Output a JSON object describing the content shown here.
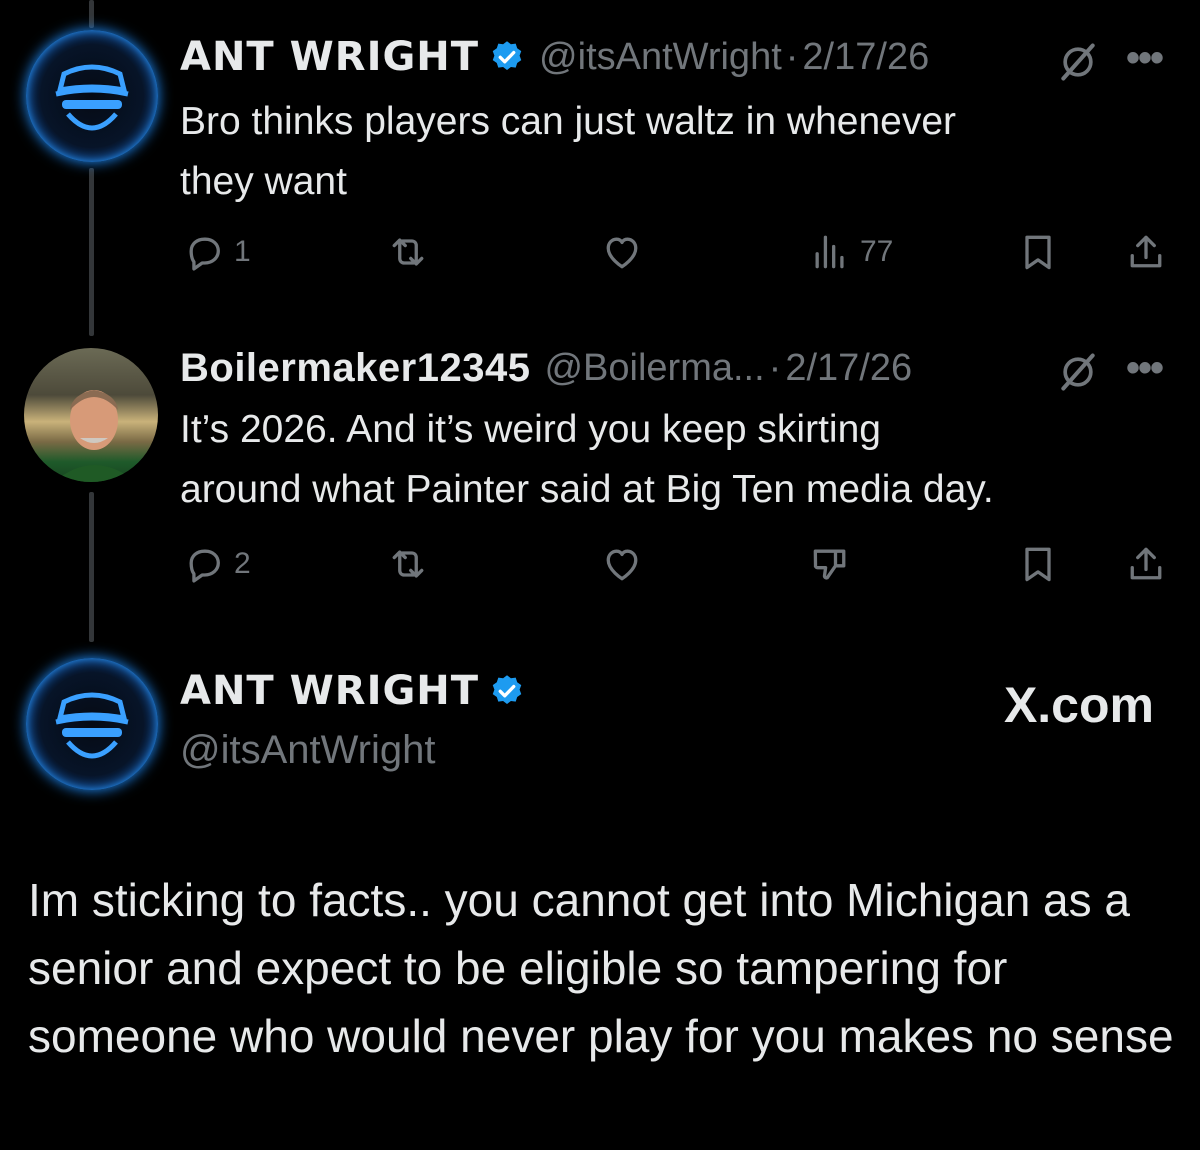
{
  "tweets": [
    {
      "display_name": "ANT WRIGHT",
      "handle": "@itsAntWright",
      "separator": "·",
      "date": "2/17/26",
      "text_line1": "Bro thinks players can just waltz in whenever",
      "text_line2": "they want",
      "reply_count": "1",
      "views_count": "77",
      "verified": true
    },
    {
      "display_name": "Boilermaker12345",
      "handle": "@Boilerma...",
      "separator": "·",
      "date": "2/17/26",
      "text_line1": "It’s 2026.  And it’s weird you keep skirting",
      "text_line2": "around what Painter said at Big Ten media day.",
      "reply_count": "2"
    }
  ],
  "main_tweet": {
    "display_name": "ANT WRIGHT",
    "handle": "@itsAntWright",
    "verified": true,
    "watermark": "X.com",
    "text": "Im sticking to facts.. you cannot get into Michigan as a senior and expect to be eligible so tampering for someone who would never play for you makes no sense"
  },
  "colors": {
    "background": "#000000",
    "text": "#e7e9ea",
    "secondary": "#71767b",
    "verified": "#1d9bf0",
    "thread_line": "#333639"
  },
  "icons": [
    "reply-icon",
    "retweet-icon",
    "like-icon",
    "views-icon",
    "dislike-icon",
    "bookmark-icon",
    "share-icon",
    "grok-icon",
    "more-icon",
    "verified-badge-icon"
  ]
}
